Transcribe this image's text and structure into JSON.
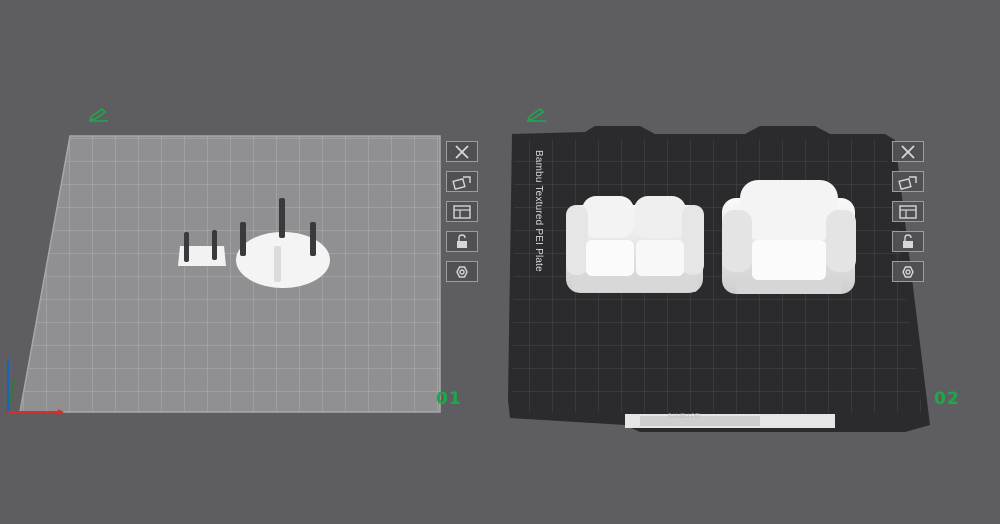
{
  "plates": [
    {
      "number": "01",
      "active": false,
      "bed_label": ""
    },
    {
      "number": "02",
      "active": true,
      "bed_label": "Bambu Textured PEI Plate",
      "strip_text": "BAMBU PEI"
    }
  ],
  "plate_tools": [
    {
      "icon": "close-icon"
    },
    {
      "icon": "auto-orient-icon"
    },
    {
      "icon": "arrange-icon"
    },
    {
      "icon": "lock-icon"
    },
    {
      "icon": "settings-icon"
    }
  ],
  "colors": {
    "background": "#5e5e62",
    "bed_grid": "#9a9a9d",
    "bed_textured": "#2b2b2e",
    "accent_green": "#1ea84a",
    "axis_x": "#d32f2f",
    "axis_y": "#2e7d32",
    "axis_z": "#1565c0"
  }
}
